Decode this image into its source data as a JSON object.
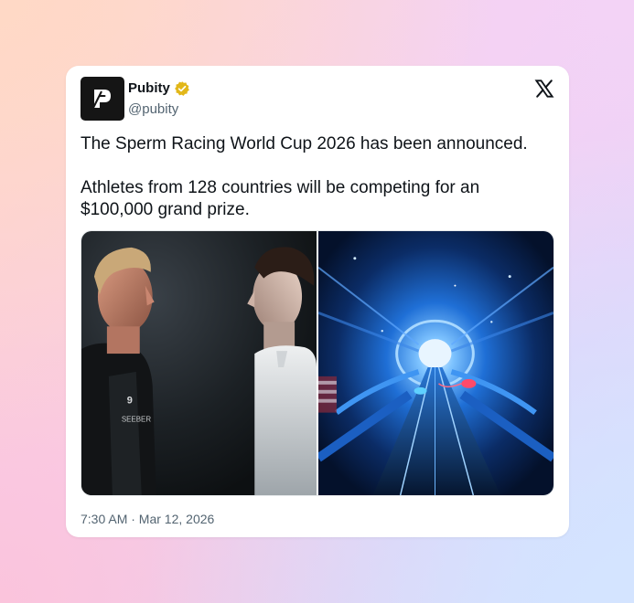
{
  "tweet": {
    "author": {
      "display_name": "Pubity",
      "handle": "@pubity",
      "verified": true,
      "avatar_icon": "pubity-logo-icon"
    },
    "platform_icon": "x-logo-icon",
    "text_paragraphs": [
      "The Sperm Racing World Cup 2026 has been announced.",
      "Athletes from 128 countries will be competing for an $100,000 grand prize."
    ],
    "media": [
      {
        "description_icon": "athletes-faceoff-photo"
      },
      {
        "description_icon": "race-tunnel-render"
      }
    ],
    "timestamp": "7:30 AM · Mar 12, 2026"
  },
  "colors": {
    "text_primary": "#0f1419",
    "text_secondary": "#536471",
    "verified_gold": "#e2b719",
    "avatar_bg": "#151515"
  }
}
